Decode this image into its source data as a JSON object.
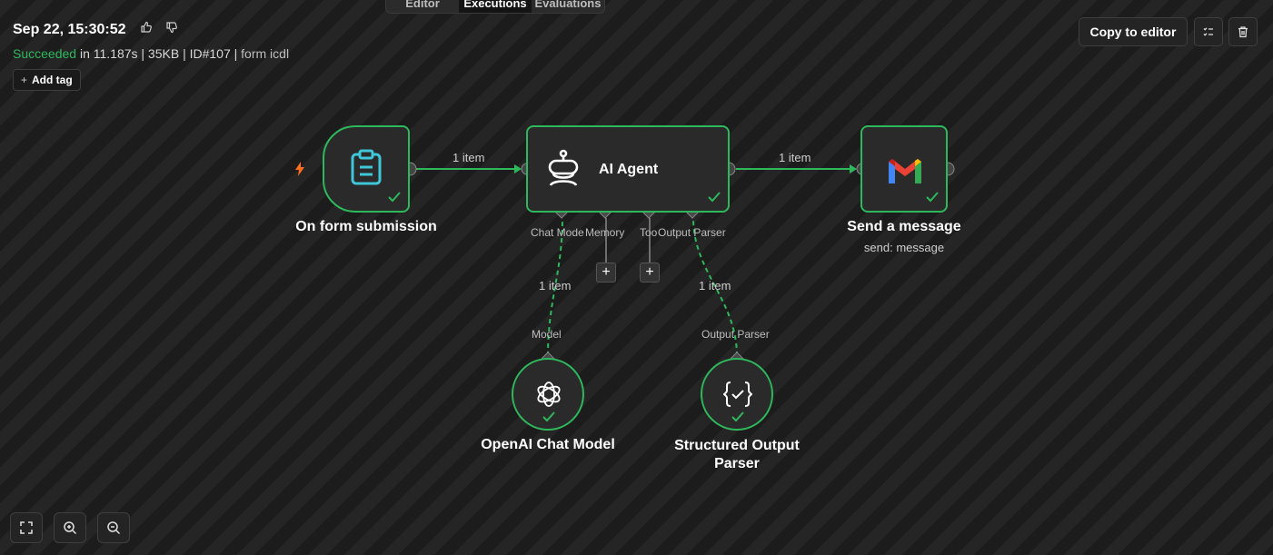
{
  "tabs": [
    {
      "label": "Editor"
    },
    {
      "label": "Executions"
    },
    {
      "label": "Evaluations"
    }
  ],
  "header": {
    "timestamp": "Sep 22, 15:30:52",
    "status": "Succeeded",
    "details": "in 11.187s | 35KB | ID#107 |",
    "workflow_name": "form icdl",
    "add_tag_label": "Add tag",
    "copy_label": "Copy to editor"
  },
  "nodes": {
    "form": {
      "label": "On form submission"
    },
    "agent": {
      "label": "AI Agent"
    },
    "gmail": {
      "label": "Send a message",
      "subtitle": "send: message"
    },
    "openai": {
      "label": "OpenAI Chat Model"
    },
    "parser": {
      "label": "Structured Output\nParser",
      "line1": "Structured Output",
      "line2": "Parser"
    }
  },
  "agent_ports": {
    "chat_model": "Chat Mode",
    "memory": "Memory",
    "tool": "Too",
    "output_parser": "Output Parser"
  },
  "child_ports": {
    "model": "Model",
    "output_parser": "Output Parser"
  },
  "edges": {
    "form_to_agent": "1 item",
    "agent_to_gmail": "1 item",
    "model_to_agent": "1 item",
    "parser_to_agent": "1 item"
  },
  "colors": {
    "success": "#2eb85c",
    "trigger": "#ff6d1f",
    "form_icon": "#3fc6d9"
  }
}
